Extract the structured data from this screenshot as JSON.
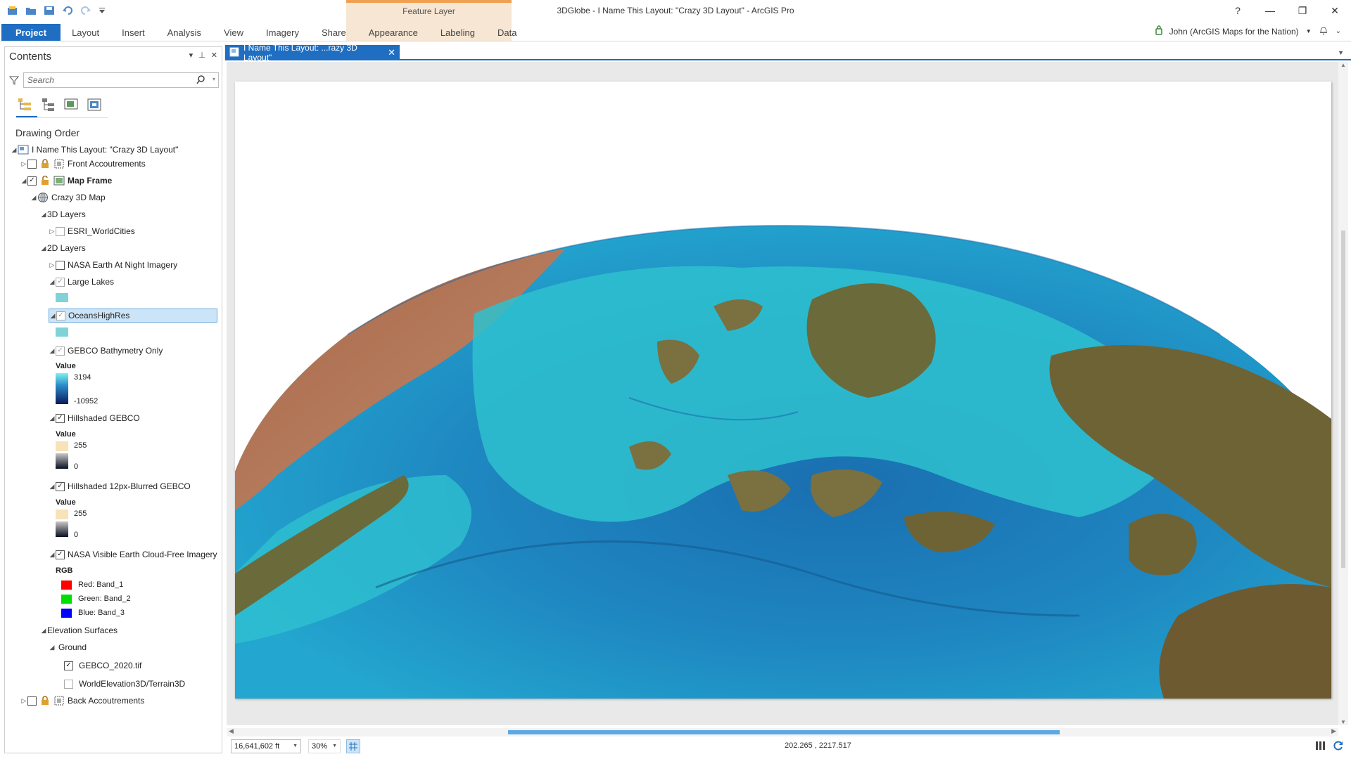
{
  "window": {
    "title": "3DGlobe - I Name This Layout: \"Crazy 3D Layout\" - ArcGIS Pro",
    "help": "?",
    "minimize": "—",
    "restore": "❐",
    "close": "✕"
  },
  "contextual": {
    "label": "Feature Layer"
  },
  "ribbon": {
    "tabs": [
      "Project",
      "Layout",
      "Insert",
      "Analysis",
      "View",
      "Imagery",
      "Share",
      "Appearance",
      "Labeling",
      "Data"
    ]
  },
  "user": {
    "name": "John (ArcGIS Maps for the Nation)"
  },
  "contents": {
    "title": "Contents",
    "search_placeholder": "Search",
    "section": "Drawing Order",
    "root": "I Name This Layout: \"Crazy 3D Layout\"",
    "front": "Front Accoutrements",
    "map_frame": "Map Frame",
    "map": "Crazy 3D Map",
    "layers_3d": "3D Layers",
    "world_cities": "ESRI_WorldCities",
    "layers_2d": "2D Layers",
    "nasa_night": "NASA Earth At Night Imagery",
    "large_lakes": "Large Lakes",
    "oceans": "OceansHighRes",
    "gebco_bathy": "GEBCO Bathymetry Only",
    "value_label": "Value",
    "bathy_high": "3194",
    "bathy_low": "-10952",
    "hillshade": "Hillshaded GEBCO",
    "hs_high": "255",
    "hs_low": "0",
    "hillshade_blur": "Hillshaded 12px-Blurred GEBCO",
    "hsb_high": "255",
    "hsb_low": "0",
    "visible_earth": "NASA Visible Earth Cloud-Free Imagery",
    "rgb_label": "RGB",
    "red": "Red:   Band_1",
    "green": "Green: Band_2",
    "blue": "Blue:  Band_3",
    "elevation": "Elevation Surfaces",
    "ground": "Ground",
    "gebco_tif": "GEBCO_2020.tif",
    "world_elev": "WorldElevation3D/Terrain3D",
    "back": "Back Accoutrements"
  },
  "view_tab": {
    "label": "I Name This Layout: ...razy 3D Layout\"",
    "close": "✕"
  },
  "status": {
    "scale": "16,641,602 ft",
    "zoom": "30%",
    "coords": "202.265 , 2217.517"
  },
  "colors": {
    "accent": "#1f6ec2",
    "lake_swatch": "#7fd3d6",
    "ocean_swatch": "#7fd3d6",
    "red": "#ff0000",
    "green": "#00e000",
    "blue": "#0000ff"
  }
}
